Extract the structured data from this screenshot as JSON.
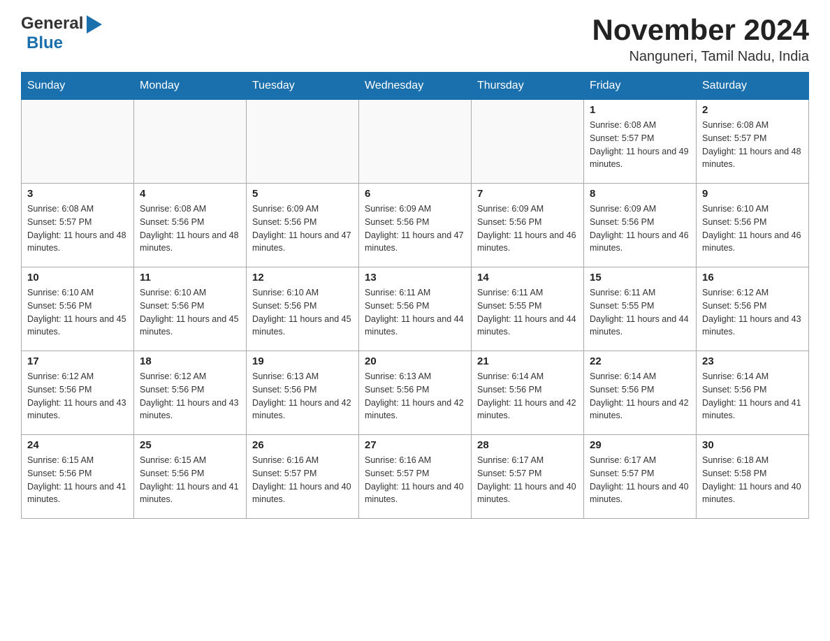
{
  "header": {
    "logo_general": "General",
    "logo_blue": "Blue",
    "month_title": "November 2024",
    "location": "Nanguneri, Tamil Nadu, India"
  },
  "days_of_week": [
    "Sunday",
    "Monday",
    "Tuesday",
    "Wednesday",
    "Thursday",
    "Friday",
    "Saturday"
  ],
  "weeks": [
    {
      "cells": [
        {
          "day": null
        },
        {
          "day": null
        },
        {
          "day": null
        },
        {
          "day": null
        },
        {
          "day": null
        },
        {
          "day": "1",
          "sunrise": "Sunrise: 6:08 AM",
          "sunset": "Sunset: 5:57 PM",
          "daylight": "Daylight: 11 hours and 49 minutes."
        },
        {
          "day": "2",
          "sunrise": "Sunrise: 6:08 AM",
          "sunset": "Sunset: 5:57 PM",
          "daylight": "Daylight: 11 hours and 48 minutes."
        }
      ]
    },
    {
      "cells": [
        {
          "day": "3",
          "sunrise": "Sunrise: 6:08 AM",
          "sunset": "Sunset: 5:57 PM",
          "daylight": "Daylight: 11 hours and 48 minutes."
        },
        {
          "day": "4",
          "sunrise": "Sunrise: 6:08 AM",
          "sunset": "Sunset: 5:56 PM",
          "daylight": "Daylight: 11 hours and 48 minutes."
        },
        {
          "day": "5",
          "sunrise": "Sunrise: 6:09 AM",
          "sunset": "Sunset: 5:56 PM",
          "daylight": "Daylight: 11 hours and 47 minutes."
        },
        {
          "day": "6",
          "sunrise": "Sunrise: 6:09 AM",
          "sunset": "Sunset: 5:56 PM",
          "daylight": "Daylight: 11 hours and 47 minutes."
        },
        {
          "day": "7",
          "sunrise": "Sunrise: 6:09 AM",
          "sunset": "Sunset: 5:56 PM",
          "daylight": "Daylight: 11 hours and 46 minutes."
        },
        {
          "day": "8",
          "sunrise": "Sunrise: 6:09 AM",
          "sunset": "Sunset: 5:56 PM",
          "daylight": "Daylight: 11 hours and 46 minutes."
        },
        {
          "day": "9",
          "sunrise": "Sunrise: 6:10 AM",
          "sunset": "Sunset: 5:56 PM",
          "daylight": "Daylight: 11 hours and 46 minutes."
        }
      ]
    },
    {
      "cells": [
        {
          "day": "10",
          "sunrise": "Sunrise: 6:10 AM",
          "sunset": "Sunset: 5:56 PM",
          "daylight": "Daylight: 11 hours and 45 minutes."
        },
        {
          "day": "11",
          "sunrise": "Sunrise: 6:10 AM",
          "sunset": "Sunset: 5:56 PM",
          "daylight": "Daylight: 11 hours and 45 minutes."
        },
        {
          "day": "12",
          "sunrise": "Sunrise: 6:10 AM",
          "sunset": "Sunset: 5:56 PM",
          "daylight": "Daylight: 11 hours and 45 minutes."
        },
        {
          "day": "13",
          "sunrise": "Sunrise: 6:11 AM",
          "sunset": "Sunset: 5:56 PM",
          "daylight": "Daylight: 11 hours and 44 minutes."
        },
        {
          "day": "14",
          "sunrise": "Sunrise: 6:11 AM",
          "sunset": "Sunset: 5:55 PM",
          "daylight": "Daylight: 11 hours and 44 minutes."
        },
        {
          "day": "15",
          "sunrise": "Sunrise: 6:11 AM",
          "sunset": "Sunset: 5:55 PM",
          "daylight": "Daylight: 11 hours and 44 minutes."
        },
        {
          "day": "16",
          "sunrise": "Sunrise: 6:12 AM",
          "sunset": "Sunset: 5:56 PM",
          "daylight": "Daylight: 11 hours and 43 minutes."
        }
      ]
    },
    {
      "cells": [
        {
          "day": "17",
          "sunrise": "Sunrise: 6:12 AM",
          "sunset": "Sunset: 5:56 PM",
          "daylight": "Daylight: 11 hours and 43 minutes."
        },
        {
          "day": "18",
          "sunrise": "Sunrise: 6:12 AM",
          "sunset": "Sunset: 5:56 PM",
          "daylight": "Daylight: 11 hours and 43 minutes."
        },
        {
          "day": "19",
          "sunrise": "Sunrise: 6:13 AM",
          "sunset": "Sunset: 5:56 PM",
          "daylight": "Daylight: 11 hours and 42 minutes."
        },
        {
          "day": "20",
          "sunrise": "Sunrise: 6:13 AM",
          "sunset": "Sunset: 5:56 PM",
          "daylight": "Daylight: 11 hours and 42 minutes."
        },
        {
          "day": "21",
          "sunrise": "Sunrise: 6:14 AM",
          "sunset": "Sunset: 5:56 PM",
          "daylight": "Daylight: 11 hours and 42 minutes."
        },
        {
          "day": "22",
          "sunrise": "Sunrise: 6:14 AM",
          "sunset": "Sunset: 5:56 PM",
          "daylight": "Daylight: 11 hours and 42 minutes."
        },
        {
          "day": "23",
          "sunrise": "Sunrise: 6:14 AM",
          "sunset": "Sunset: 5:56 PM",
          "daylight": "Daylight: 11 hours and 41 minutes."
        }
      ]
    },
    {
      "cells": [
        {
          "day": "24",
          "sunrise": "Sunrise: 6:15 AM",
          "sunset": "Sunset: 5:56 PM",
          "daylight": "Daylight: 11 hours and 41 minutes."
        },
        {
          "day": "25",
          "sunrise": "Sunrise: 6:15 AM",
          "sunset": "Sunset: 5:56 PM",
          "daylight": "Daylight: 11 hours and 41 minutes."
        },
        {
          "day": "26",
          "sunrise": "Sunrise: 6:16 AM",
          "sunset": "Sunset: 5:57 PM",
          "daylight": "Daylight: 11 hours and 40 minutes."
        },
        {
          "day": "27",
          "sunrise": "Sunrise: 6:16 AM",
          "sunset": "Sunset: 5:57 PM",
          "daylight": "Daylight: 11 hours and 40 minutes."
        },
        {
          "day": "28",
          "sunrise": "Sunrise: 6:17 AM",
          "sunset": "Sunset: 5:57 PM",
          "daylight": "Daylight: 11 hours and 40 minutes."
        },
        {
          "day": "29",
          "sunrise": "Sunrise: 6:17 AM",
          "sunset": "Sunset: 5:57 PM",
          "daylight": "Daylight: 11 hours and 40 minutes."
        },
        {
          "day": "30",
          "sunrise": "Sunrise: 6:18 AM",
          "sunset": "Sunset: 5:58 PM",
          "daylight": "Daylight: 11 hours and 40 minutes."
        }
      ]
    }
  ]
}
